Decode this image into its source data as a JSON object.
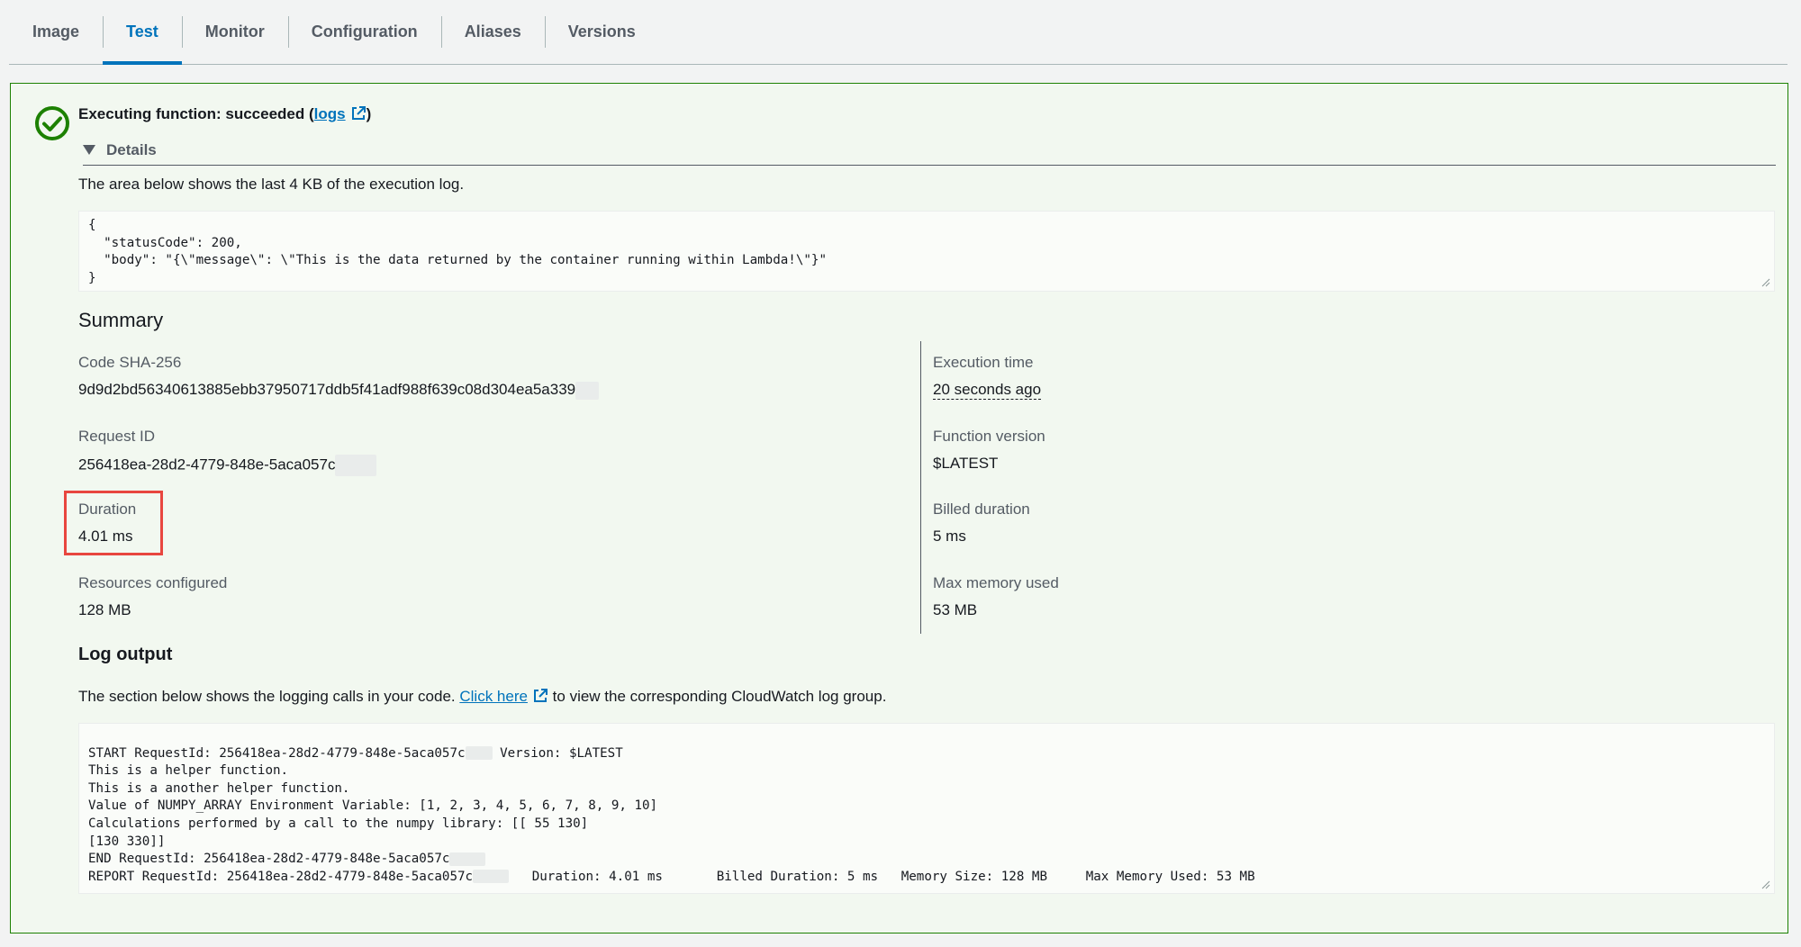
{
  "tabs": [
    {
      "label": "Image"
    },
    {
      "label": "Test"
    },
    {
      "label": "Monitor"
    },
    {
      "label": "Configuration"
    },
    {
      "label": "Aliases"
    },
    {
      "label": "Versions"
    }
  ],
  "active_tab": "Test",
  "result": {
    "status_prefix": "Executing function: succeeded (",
    "logs_link": "logs",
    "status_suffix": ")",
    "details_label": "Details",
    "description": "The area below shows the last 4 KB of the execution log.",
    "execution_log": "{\n  \"statusCode\": 200,\n  \"body\": \"{\\\"message\\\": \\\"This is the data returned by the container running within Lambda!\\\"}\"\n}"
  },
  "summary": {
    "title": "Summary",
    "code_sha_label": "Code SHA-256",
    "code_sha_value": "9d9d2bd56340613885ebb37950717ddb5f41adf988f639c08d304ea5a339",
    "request_id_label": "Request ID",
    "request_id_value": "256418ea-28d2-4779-848e-5aca057c",
    "duration_label": "Duration",
    "duration_value": "4.01 ms",
    "resources_label": "Resources configured",
    "resources_value": "128 MB",
    "exec_time_label": "Execution time",
    "exec_time_value": "20 seconds ago",
    "function_version_label": "Function version",
    "function_version_value": "$LATEST",
    "billed_label": "Billed duration",
    "billed_value": "5 ms",
    "max_mem_label": "Max memory used",
    "max_mem_value": "53 MB"
  },
  "log_output": {
    "title": "Log output",
    "desc_prefix": "The section below shows the logging calls in your code. ",
    "click_here": "Click here",
    "desc_suffix": " to view the corresponding CloudWatch log group.",
    "lines": {
      "l1a": "START RequestId: 256418ea-28d2-4779-848e-5aca057c",
      "l1b": " Version: $LATEST",
      "l2": "This is a helper function.",
      "l3": "This is a another helper function.",
      "l4": "Value of NUMPY_ARRAY Environment Variable: [1, 2, 3, 4, 5, 6, 7, 8, 9, 10]",
      "l5": "Calculations performed by a call to the numpy library: [[ 55 130]",
      "l6": "[130 330]]",
      "l7": "END RequestId: 256418ea-28d2-4779-848e-5aca057c",
      "l8a": "REPORT RequestId: 256418ea-28d2-4779-848e-5aca057c",
      "l8b": "   Duration: 4.01 ms       Billed Duration: 5 ms   Memory Size: 128 MB     Max Memory Used: 53 MB"
    }
  },
  "colors": {
    "accent": "#0073bb",
    "success": "#1d8102",
    "highlight": "#e8463f"
  }
}
